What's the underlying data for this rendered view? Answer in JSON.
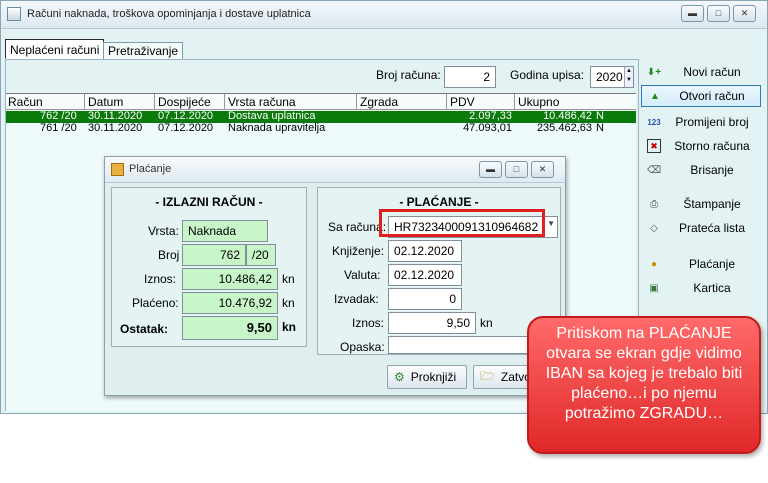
{
  "window": {
    "title": "Računi naknada, troškova opominjanja i dostave uplatnica",
    "buttons": [
      "minimize",
      "maximize",
      "close"
    ]
  },
  "tabs": [
    {
      "label": "Neplaćeni računi",
      "active": true
    },
    {
      "label": "Pretraživanje",
      "active": false
    }
  ],
  "filters": {
    "broj_racuna_label": "Broj računa:",
    "broj_racuna_value": "2",
    "godina_upisa_label": "Godina upisa:",
    "godina_upisa_value": "2020"
  },
  "grid": {
    "columns": [
      "Račun",
      "Datum",
      "Dospijeće",
      "Vrsta računa",
      "Zgrada",
      "PDV",
      "Ukupno"
    ],
    "rows": [
      {
        "racun": "762 /20",
        "datum": "30.11.2020",
        "dospijece": "07.12.2020",
        "vrsta": "Dostava uplatnica",
        "zgrada": "",
        "pdv": "2.097,33",
        "ukupno": "10.486,42",
        "flag": "N",
        "selected": true
      },
      {
        "racun": "761 /20",
        "datum": "30.11.2020",
        "dospijece": "07.12.2020",
        "vrsta": "Naknada upravitelja",
        "zgrada": "",
        "pdv": "47.093,01",
        "ukupno": "235.462,63",
        "flag": "N",
        "selected": false
      }
    ]
  },
  "side_buttons": [
    {
      "label": "Novi račun",
      "icon": "new-icon"
    },
    {
      "label": "Otvori račun",
      "icon": "open-icon"
    },
    {
      "label": "Promijeni broj",
      "icon": "change-number-icon"
    },
    {
      "label": "Storno računa",
      "icon": "storno-icon"
    },
    {
      "label": "Brisanje",
      "icon": "delete-icon"
    },
    {
      "label": "Štampanje",
      "icon": "print-icon"
    },
    {
      "label": "Prateća lista",
      "icon": "list-icon"
    },
    {
      "label": "Plaćanje",
      "icon": "payment-icon"
    },
    {
      "label": "Kartica",
      "icon": "card-icon"
    }
  ],
  "dialog": {
    "title": "Plaćanje",
    "izlazni": {
      "title": "- IZLAZNI RAČUN -",
      "vrsta_label": "Vrsta:",
      "vrsta_value": "Naknada",
      "broj_label": "Broj",
      "broj_value": "762",
      "broj_suffix": "/20",
      "iznos_label": "Iznos:",
      "iznos_value": "10.486,42",
      "placeno_label": "Plaćeno:",
      "placeno_value": "10.476,92",
      "ostatak_label": "Ostatak:",
      "ostatak_value": "9,50",
      "currency": "kn"
    },
    "placanje": {
      "title": "- PLAĆANJE -",
      "sa_racuna_label": "Sa računa:",
      "sa_racuna_value": "HR7323400091310964682",
      "knjizenje_label": "Knjiženje:",
      "knjizenje_value": "02.12.2020",
      "valuta_label": "Valuta:",
      "valuta_value": "02.12.2020",
      "izvadak_label": "Izvadak:",
      "izvadak_value": "0",
      "iznos_label": "Iznos:",
      "iznos_value": "9,50",
      "currency": "kn",
      "opaska_label": "Opaska:",
      "opaska_value": ""
    },
    "proknjizi_label": "Proknjiži",
    "zatvori_label": "Zatvo"
  },
  "callout": {
    "text": "Pritiskom na PLAĆANJE otvara se ekran gdje vidimo IBAN sa kojeg je trebalo biti plaćeno…i po njemu potražimo ZGRADU…"
  },
  "colors": {
    "selected_row": "#0a7a0a",
    "green_field": "#c8f5c8",
    "highlight_border": "#e02020",
    "callout_fill": "#e83030"
  }
}
